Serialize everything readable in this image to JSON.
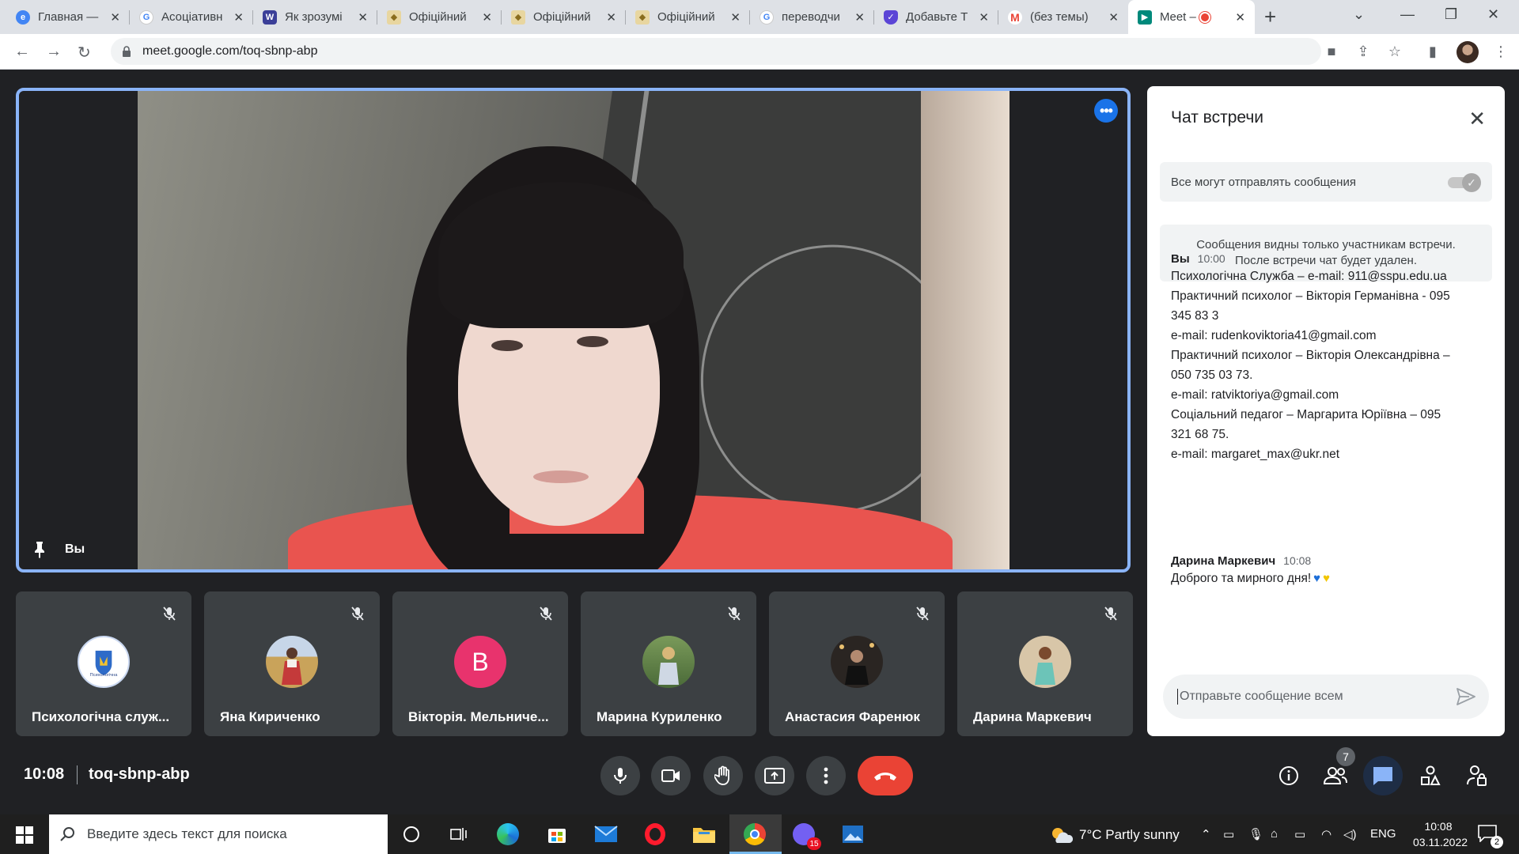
{
  "browser": {
    "tabs": [
      {
        "title": "Главная —",
        "icon": "edge-icon",
        "color": "#4285f4"
      },
      {
        "title": "Асоціативн",
        "icon": "google-icon",
        "color": "#4285f4"
      },
      {
        "title": "Як зрозумі",
        "icon": "w-icon",
        "color": "#3b3f98"
      },
      {
        "title": "Офіційний",
        "icon": "crest-icon",
        "color": "#c8a24a"
      },
      {
        "title": "Офіційний",
        "icon": "crest-icon",
        "color": "#c8a24a"
      },
      {
        "title": "Офіційний",
        "icon": "crest-icon",
        "color": "#c8a24a"
      },
      {
        "title": "переводчи",
        "icon": "google-icon",
        "color": "#4285f4"
      },
      {
        "title": "Добавьте Т",
        "icon": "shield-icon",
        "color": "#5b45d6"
      },
      {
        "title": "(без темы)",
        "icon": "gmail-icon",
        "color": "#ea4335"
      },
      {
        "title": "Meet –",
        "icon": "meet-icon",
        "color": "#00897b"
      }
    ],
    "url": "meet.google.com/toq-sbnp-abp"
  },
  "meet": {
    "main_tile": {
      "name": "Вы"
    },
    "participants": [
      {
        "name": "Психологічна служ...",
        "avatar": "logo",
        "avatar_letter": ""
      },
      {
        "name": "Яна Кириченко",
        "avatar": "photo",
        "avatar_letter": ""
      },
      {
        "name": "Вікторія. Мельниче...",
        "avatar": "letter",
        "avatar_letter": "B",
        "avatar_color": "#e8336d"
      },
      {
        "name": "Марина Куриленко",
        "avatar": "photo",
        "avatar_letter": ""
      },
      {
        "name": "Анастасия Фаренюк",
        "avatar": "photo",
        "avatar_letter": ""
      },
      {
        "name": "Дарина Маркевич",
        "avatar": "photo",
        "avatar_letter": ""
      }
    ],
    "chat": {
      "title": "Чат встречи",
      "permission_label": "Все могут отправлять сообщения",
      "permission_enabled": true,
      "notice": "Сообщения видны только участникам встречи.\nПосле встречи чат будет удален.",
      "messages": [
        {
          "sender": "Вы",
          "time": "10:00",
          "lines": [
            "Психологічна Служба – e-mail: 911@sspu.edu.ua",
            "Практичний психолог – Вікторія Германівна - 095",
            "345 83 3",
            "e-mail: rudenkoviktoria41@gmail.com",
            "Практичний психолог – Вікторія Олександрівна –",
            "050 735 03 73.",
            "e-mail: ratviktoriya@gmail.com",
            "Соціальний педагог – Маргарита Юріївна – 095",
            "321 68 75.",
            "e-mail: margaret_max@ukr.net"
          ]
        },
        {
          "sender": "Дарина Маркевич",
          "time": "10:08",
          "lines": [
            "Доброго та мирного дня!"
          ]
        }
      ],
      "compose_placeholder": "Отправьте сообщение всем"
    },
    "bottom": {
      "time": "10:08",
      "meeting_code": "toq-sbnp-abp",
      "participants_count": "7"
    }
  },
  "taskbar": {
    "search_placeholder": "Введите здесь текст для поиска",
    "weather": "7°C  Partly sunny",
    "lang": "ENG",
    "time": "10:08",
    "date": "03.11.2022",
    "viber_badge": "15",
    "notifications": "2"
  }
}
